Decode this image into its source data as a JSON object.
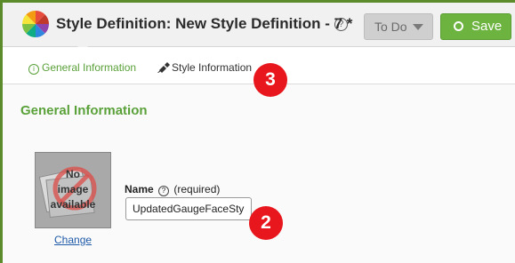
{
  "header": {
    "title": "Style Definition: New Style Definition - 7 *",
    "help_glyph": "?",
    "status_label": "To Do",
    "save_label": "Save"
  },
  "tabs": [
    {
      "label": "General Information",
      "icon": "info-icon",
      "active": true
    },
    {
      "label": "Style Information",
      "icon": "paint-brush-icon",
      "active": false
    }
  ],
  "section": {
    "title": "General Information"
  },
  "image": {
    "placeholder_text": [
      "No",
      "image",
      "available"
    ],
    "change_label": "Change"
  },
  "name_field": {
    "label": "Name",
    "help_glyph": "?",
    "required_text": "(required)",
    "value": "UpdatedGaugeFaceSty"
  },
  "annotations": [
    "3",
    "2"
  ],
  "colors": {
    "accent_green": "#5aa13a",
    "save_green": "#6cb33f",
    "frame_green": "#5c8b2b",
    "badge_red": "#e8171d"
  }
}
